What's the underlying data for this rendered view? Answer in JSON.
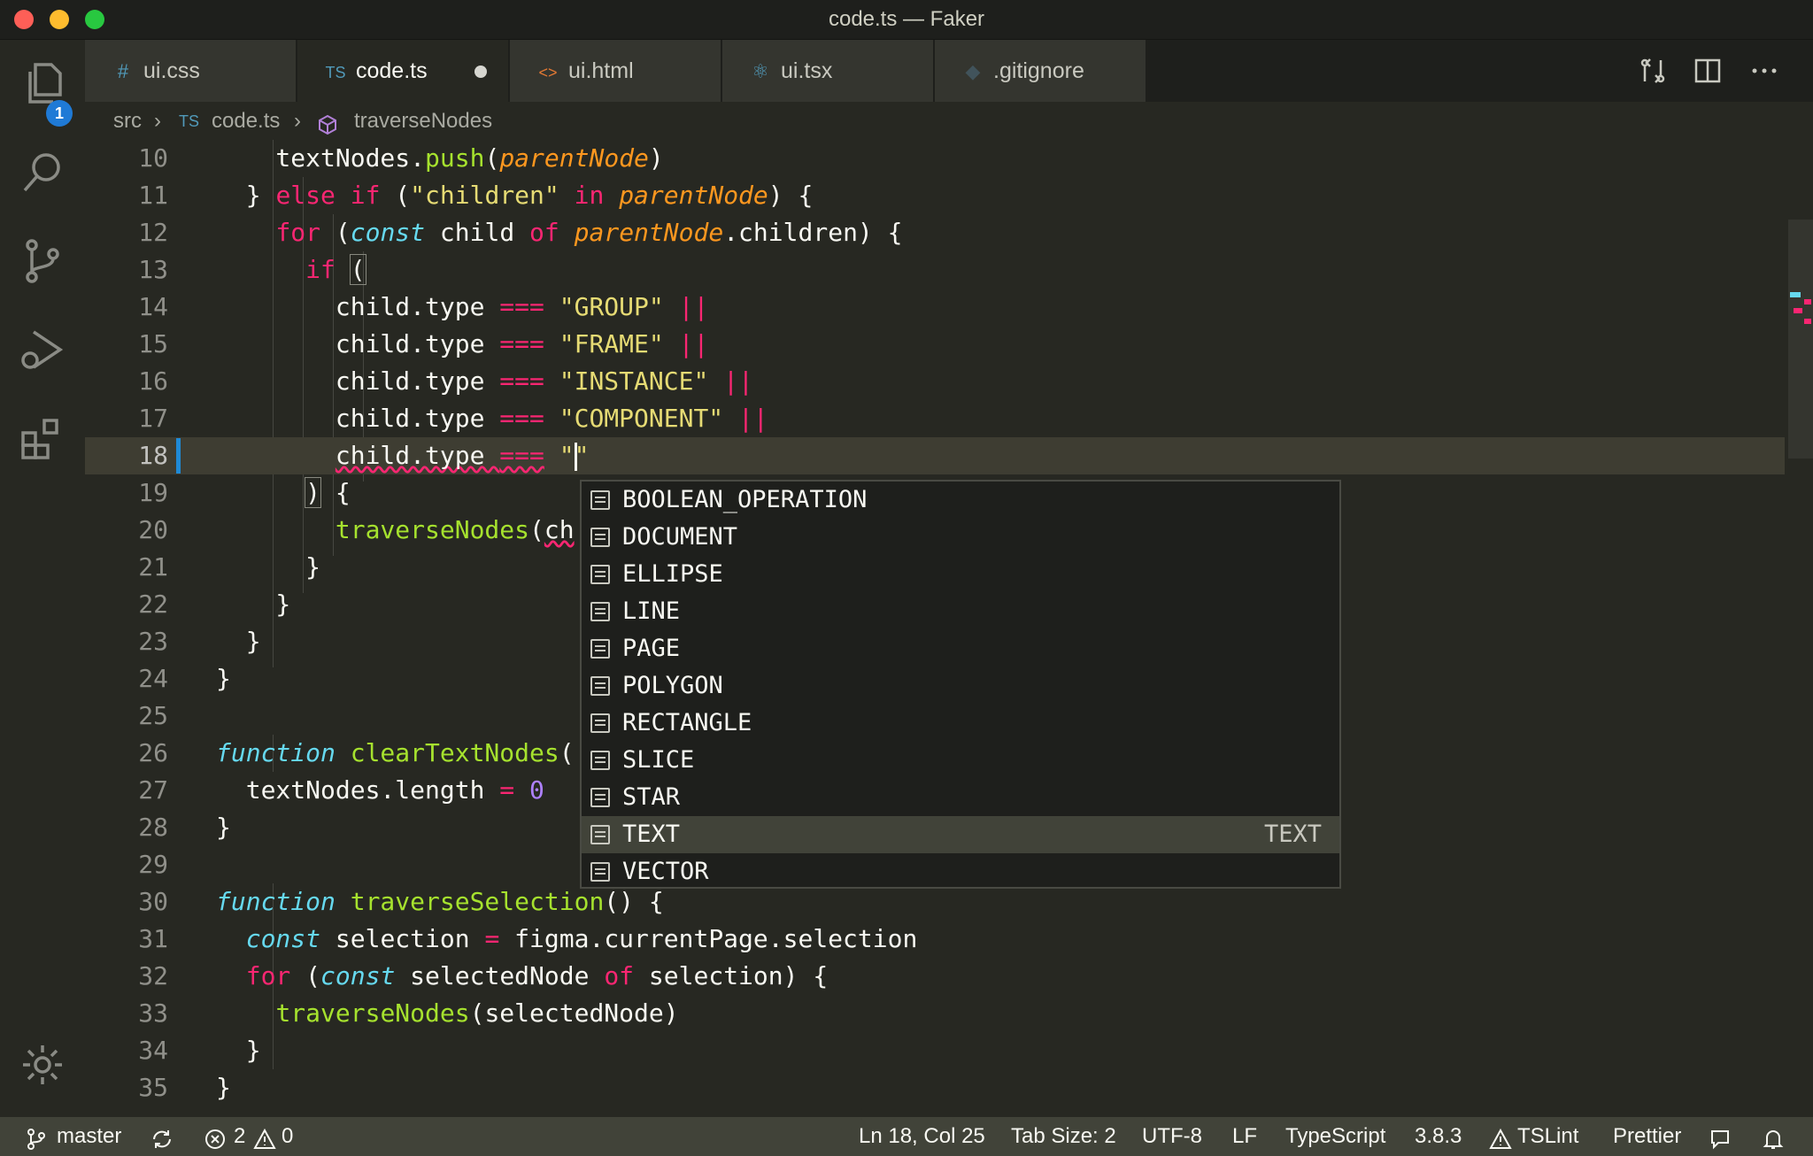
{
  "window": {
    "title": "code.ts — Faker"
  },
  "activity_bar": {
    "explorer_badge": "1"
  },
  "tabs": [
    {
      "icon": "#",
      "label": "ui.css"
    },
    {
      "icon": "TS",
      "label": "code.ts"
    },
    {
      "icon": "<>",
      "label": "ui.html"
    },
    {
      "icon": "⚛",
      "label": "ui.tsx"
    },
    {
      "icon": "◆",
      "label": ".gitignore"
    }
  ],
  "breadcrumb": {
    "folder": "src",
    "file_icon": "TS",
    "file": "code.ts",
    "symbol": "traverseNodes"
  },
  "editor": {
    "current_line": 18,
    "lines": [
      {
        "n": "10",
        "text": "    textNodes.push(parentNode)"
      },
      {
        "n": "11",
        "text": "  } else if (\"children\" in parentNode) {"
      },
      {
        "n": "12",
        "text": "    for (const child of parentNode.children) {"
      },
      {
        "n": "13",
        "text": "      if ("
      },
      {
        "n": "14",
        "text": "        child.type === \"GROUP\" ||"
      },
      {
        "n": "15",
        "text": "        child.type === \"FRAME\" ||"
      },
      {
        "n": "16",
        "text": "        child.type === \"INSTANCE\" ||"
      },
      {
        "n": "17",
        "text": "        child.type === \"COMPONENT\" ||"
      },
      {
        "n": "18",
        "text": "        child.type === \"\""
      },
      {
        "n": "19",
        "text": "      ) {"
      },
      {
        "n": "20",
        "text": "        traverseNodes(ch"
      },
      {
        "n": "21",
        "text": "      }"
      },
      {
        "n": "22",
        "text": "    }"
      },
      {
        "n": "23",
        "text": "  }"
      },
      {
        "n": "24",
        "text": "}"
      },
      {
        "n": "25",
        "text": ""
      },
      {
        "n": "26",
        "text": "function clearTextNodes("
      },
      {
        "n": "27",
        "text": "  textNodes.length = 0"
      },
      {
        "n": "28",
        "text": "}"
      },
      {
        "n": "29",
        "text": ""
      },
      {
        "n": "30",
        "text": "function traverseSelection() {"
      },
      {
        "n": "31",
        "text": "  const selection = figma.currentPage.selection"
      },
      {
        "n": "32",
        "text": "  for (const selectedNode of selection) {"
      },
      {
        "n": "33",
        "text": "    traverseNodes(selectedNode)"
      },
      {
        "n": "34",
        "text": "  }"
      },
      {
        "n": "35",
        "text": "}"
      }
    ]
  },
  "suggest": {
    "items": [
      "BOOLEAN_OPERATION",
      "DOCUMENT",
      "ELLIPSE",
      "LINE",
      "PAGE",
      "POLYGON",
      "RECTANGLE",
      "SLICE",
      "STAR",
      "TEXT",
      "VECTOR"
    ],
    "selected": "TEXT",
    "selected_detail": "TEXT"
  },
  "status": {
    "branch": "master",
    "errors": "2",
    "warnings": "0",
    "cursor": "Ln 18, Col 25",
    "indent": "Tab Size: 2",
    "encoding": "UTF-8",
    "eol": "LF",
    "language": "TypeScript",
    "ts_version": "3.8.3",
    "linter": "TSLint",
    "formatter": "Prettier"
  },
  "colors": {
    "accent": "#1f7ad6",
    "keyword": "#f92672",
    "string": "#e6db74",
    "function": "#a6e22e",
    "param": "#fd971f",
    "storage": "#66d9ef"
  },
  "icons": [
    "files-icon",
    "search-icon",
    "source-control-icon",
    "run-debug-icon",
    "extensions-icon",
    "settings-gear-icon",
    "compare-changes-icon",
    "split-editor-icon",
    "more-actions-icon",
    "symbol-method-icon",
    "branch-icon",
    "sync-icon",
    "error-icon",
    "warning-icon",
    "feedback-icon",
    "bell-icon",
    "enum-member-icon"
  ]
}
